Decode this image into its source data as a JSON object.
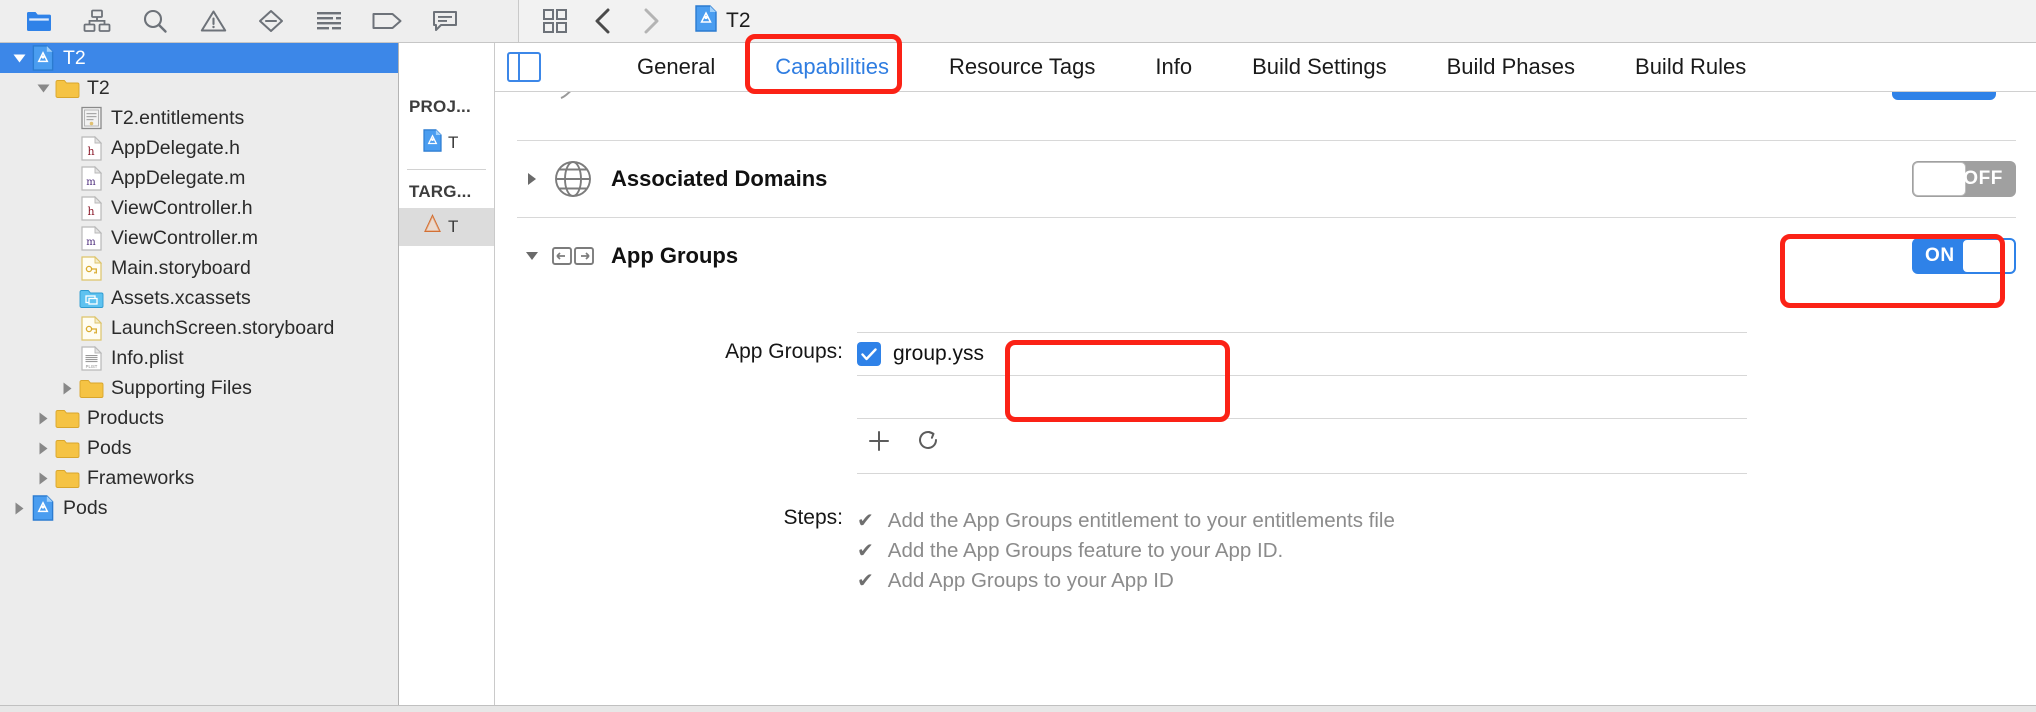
{
  "window": {
    "title": "T2"
  },
  "navigator_toolbar": {
    "icons": [
      {
        "name": "folder-icon",
        "label": "Project navigator"
      },
      {
        "name": "hierarchy-icon",
        "label": "Source control navigator"
      },
      {
        "name": "search-icon",
        "label": "Find navigator"
      },
      {
        "name": "warning-triangle-icon",
        "label": "Issue navigator"
      },
      {
        "name": "minus-diamond-icon",
        "label": "Test navigator"
      },
      {
        "name": "list-lines-icon",
        "label": "Debug navigator"
      },
      {
        "name": "breakpoint-tag-icon",
        "label": "Breakpoint navigator"
      },
      {
        "name": "speech-bubble-icon",
        "label": "Report navigator"
      }
    ]
  },
  "editor_toolbar": {
    "grid_icon": "grid-squares-icon",
    "back_icon": "chevron-left-icon",
    "forward_icon": "chevron-right-icon",
    "breadcrumb_icon": "xcode-project-icon",
    "breadcrumb_label": "T2"
  },
  "navigator": {
    "items": [
      {
        "label": "T2",
        "icon": "xcode-project-icon",
        "indent": 0,
        "twisty": "down",
        "selected": true
      },
      {
        "label": "T2",
        "icon": "folder-yellow-icon",
        "indent": 1,
        "twisty": "down",
        "selected": false
      },
      {
        "label": "T2.entitlements",
        "icon": "entitlements-icon",
        "indent": 2,
        "twisty": "none",
        "selected": false
      },
      {
        "label": "AppDelegate.h",
        "icon": "header-file-icon",
        "indent": 2,
        "twisty": "none",
        "selected": false
      },
      {
        "label": "AppDelegate.m",
        "icon": "source-file-icon",
        "indent": 2,
        "twisty": "none",
        "selected": false
      },
      {
        "label": "ViewController.h",
        "icon": "header-file-icon",
        "indent": 2,
        "twisty": "none",
        "selected": false
      },
      {
        "label": "ViewController.m",
        "icon": "source-file-icon",
        "indent": 2,
        "twisty": "none",
        "selected": false
      },
      {
        "label": "Main.storyboard",
        "icon": "storyboard-icon",
        "indent": 2,
        "twisty": "none",
        "selected": false
      },
      {
        "label": "Assets.xcassets",
        "icon": "xcassets-icon",
        "indent": 2,
        "twisty": "none",
        "selected": false
      },
      {
        "label": "LaunchScreen.storyboard",
        "icon": "storyboard-icon",
        "indent": 2,
        "twisty": "none",
        "selected": false
      },
      {
        "label": "Info.plist",
        "icon": "plist-icon",
        "indent": 2,
        "twisty": "none",
        "selected": false
      },
      {
        "label": "Supporting Files",
        "icon": "folder-yellow-icon",
        "indent": 2,
        "twisty": "right",
        "selected": false
      },
      {
        "label": "Products",
        "icon": "folder-yellow-icon",
        "indent": 1,
        "twisty": "right",
        "selected": false
      },
      {
        "label": "Pods",
        "icon": "folder-yellow-icon",
        "indent": 1,
        "twisty": "right",
        "selected": false
      },
      {
        "label": "Frameworks",
        "icon": "folder-yellow-icon",
        "indent": 1,
        "twisty": "right",
        "selected": false
      },
      {
        "label": "Pods",
        "icon": "xcode-project-icon",
        "indent": 0,
        "twisty": "right",
        "selected": false
      }
    ]
  },
  "targets_pane": {
    "project_header": "PROJ...",
    "project_item": "T",
    "targets_header": "TARG...",
    "target_item": "T"
  },
  "tabs": [
    {
      "label": "General",
      "active": false
    },
    {
      "label": "Capabilities",
      "active": true
    },
    {
      "label": "Resource Tags",
      "active": false
    },
    {
      "label": "Info",
      "active": false
    },
    {
      "label": "Build Settings",
      "active": false
    },
    {
      "label": "Build Phases",
      "active": false
    },
    {
      "label": "Build Rules",
      "active": false
    }
  ],
  "capabilities": {
    "associated_domains": {
      "title": "Associated Domains",
      "icon": "globe-icon",
      "switch_label": "OFF",
      "switch_state": "off",
      "disclosure": "right"
    },
    "app_groups": {
      "title": "App Groups",
      "icon": "app-groups-icon",
      "switch_label": "ON",
      "switch_state": "on",
      "disclosure": "down",
      "field_label": "App Groups:",
      "entries": [
        {
          "name": "group.yss",
          "checked": true
        }
      ],
      "empty_rows": 1,
      "add_icon": "plus-icon",
      "refresh_icon": "refresh-icon",
      "steps_label": "Steps:",
      "steps": [
        {
          "check": "✔",
          "text": "Add the App Groups entitlement to your entitlements file"
        },
        {
          "check": "✔",
          "text": "Add the App Groups feature to your App ID."
        },
        {
          "check": "✔",
          "text": "Add App Groups to your App ID"
        }
      ]
    }
  },
  "annotations": [
    {
      "name": "annot-capabilities",
      "target": "Capabilities tab",
      "color": "#fb2216"
    },
    {
      "name": "annot-toggle",
      "target": "App Groups ON switch",
      "color": "#fb2216"
    },
    {
      "name": "annot-group",
      "target": "group.yss checkbox",
      "color": "#fb2216"
    }
  ],
  "colors": {
    "accent": "#2f82e8",
    "selection": "#3c87e8",
    "annotation": "#fb2216",
    "folder": "#f5c344"
  }
}
